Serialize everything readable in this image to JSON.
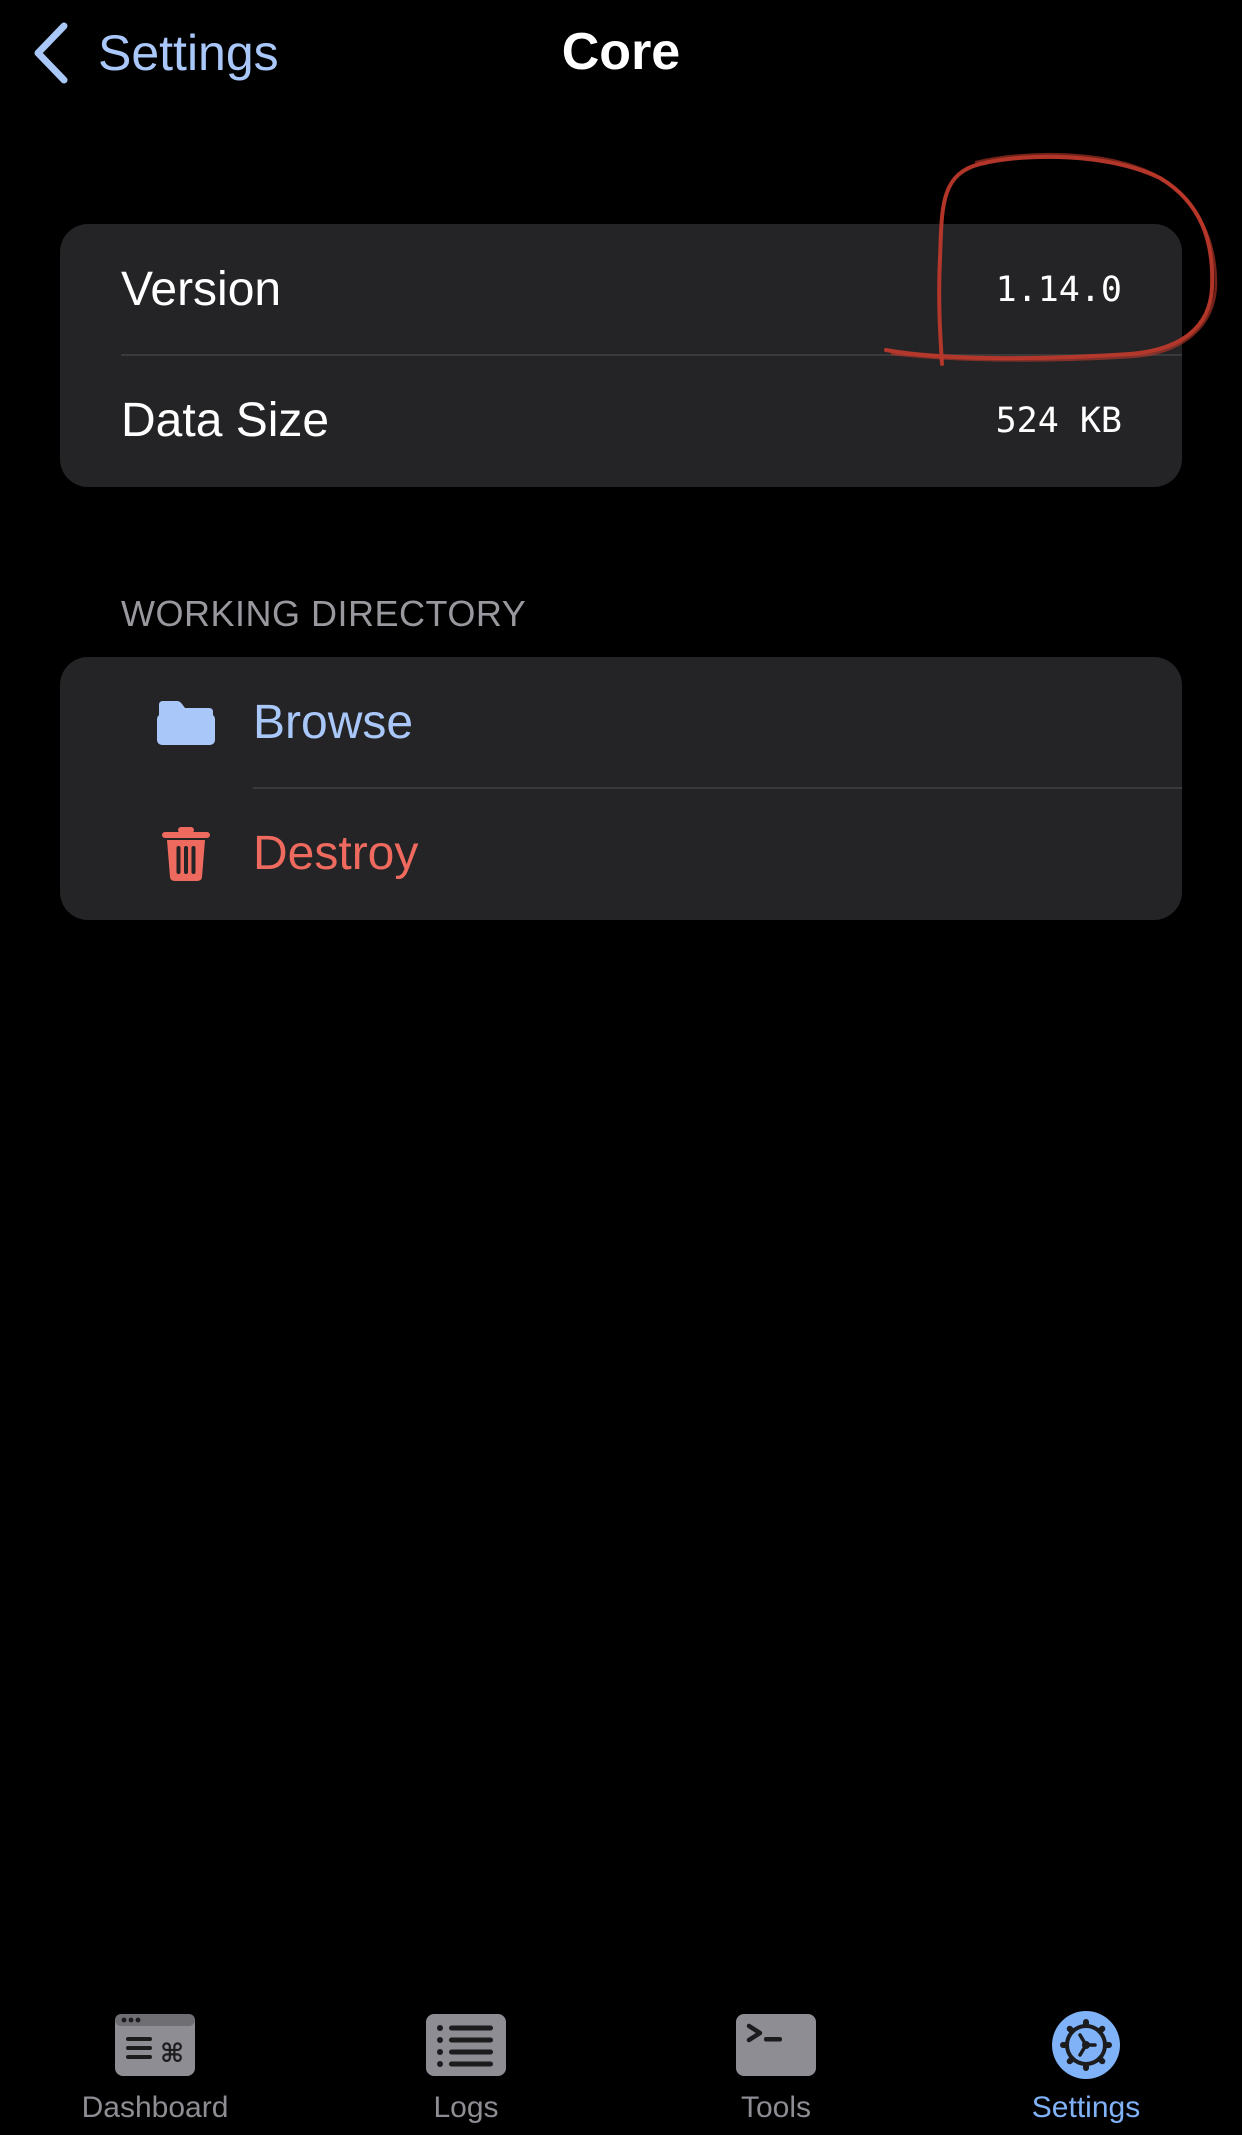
{
  "nav": {
    "back_label": "Settings",
    "title": "Core"
  },
  "info_card": {
    "rows": [
      {
        "label": "Version",
        "value": "1.14.0"
      },
      {
        "label": "Data Size",
        "value": "524 KB"
      }
    ]
  },
  "working_directory": {
    "header": "WORKING DIRECTORY",
    "actions": [
      {
        "label": "Browse",
        "icon": "folder-icon"
      },
      {
        "label": "Destroy",
        "icon": "trash-icon"
      }
    ]
  },
  "tabs": [
    {
      "label": "Dashboard",
      "icon": "dashboard-icon",
      "selected": false
    },
    {
      "label": "Logs",
      "icon": "logs-icon",
      "selected": false
    },
    {
      "label": "Tools",
      "icon": "terminal-icon",
      "selected": false
    },
    {
      "label": "Settings",
      "icon": "gear-icon",
      "selected": true
    }
  ],
  "colors": {
    "background": "#000000",
    "card": "#242426",
    "accent": "#a9c8f9",
    "destructive": "#ef6a5e",
    "secondary_text": "#98989e",
    "tab_inactive": "#8d8d93",
    "tab_active": "#7fb2f7",
    "annotation": "#c0392b"
  }
}
